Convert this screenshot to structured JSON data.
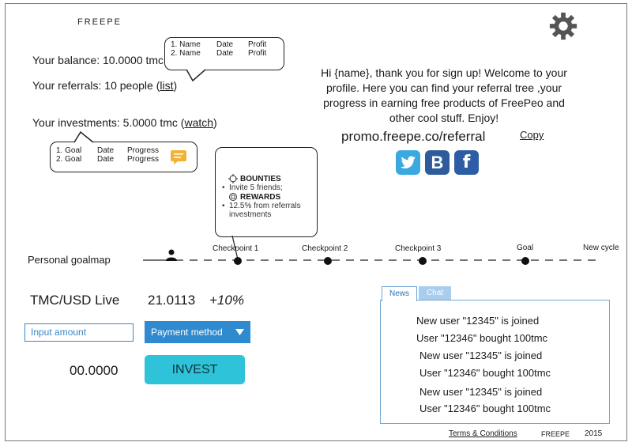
{
  "brand": "FREEPE",
  "icons": {
    "settings": "gear-icon",
    "goal_user": "user-icon",
    "bounties": "target-icon",
    "rewards": "gift-icon",
    "comment": "comment-icon",
    "dropdown": "caret-down-icon"
  },
  "colors": {
    "accent": "#2f8ad0",
    "invest": "#2ec3d8",
    "twitter": "#39a9e0",
    "vk": "#2e5c9a",
    "facebook": "#2d5ea5",
    "comment": "#f2b233"
  },
  "balance": {
    "label": "Your balance: 10.0000 tmc"
  },
  "referrals": {
    "label": "Your referrals: 10 people (",
    "link": "list",
    "close": ")"
  },
  "investments": {
    "label": "Your investments: 5.0000 tmc (",
    "link": "watch",
    "close": ")"
  },
  "referral_popup": {
    "rows": [
      {
        "c1": "1. Name",
        "c2": "Date",
        "c3": "Profit"
      },
      {
        "c1": "2. Name",
        "c2": "Date",
        "c3": "Profit"
      }
    ]
  },
  "investment_popup": {
    "rows": [
      {
        "c1": "1. Goal",
        "c2": "Date",
        "c3": "Progress"
      },
      {
        "c1": "2. Goal",
        "c2": "Date",
        "c3": "Progress"
      }
    ]
  },
  "welcome": "Hi {name}, thank you for sign up! Welcome to your profile. Here you can find your referral tree ,your progress in earning free products of FreePeo and other cool stuff. Enjoy!",
  "promo": {
    "url": "promo.freepe.co/referral",
    "copy": "Copy"
  },
  "goal_popup": {
    "bounties_title": "BOUNTIES",
    "bounties_item": "Invite 5 friends;",
    "rewards_title": "REWARDS",
    "rewards_item": "12.5% from referrals investments"
  },
  "goalmap": {
    "label": "Personal goalmap",
    "checkpoints": [
      "Checkpoint 1",
      "Checkpoint 2",
      "Checkpoint 3",
      "Goal",
      "New cycle"
    ]
  },
  "ticker": {
    "pair": "TMC/USD Live",
    "rate": "21.0113",
    "change": "+10%"
  },
  "invest": {
    "input_placeholder": "Input amount",
    "payment": "Payment method",
    "amount": "00.0000",
    "button": "INVEST"
  },
  "feed": {
    "tabs": [
      "News",
      "Chat"
    ],
    "items": [
      "New user \"12345\" is joined",
      "User \"12346\" bought 100tmc",
      "New user \"12345\" is joined",
      "User \"12346\" bought 100tmc",
      "New user \"12345\" is joined",
      "User \"12346\" bought 100tmc"
    ]
  },
  "footer": {
    "terms": "Terms & Conditions",
    "brand": "FREEPE",
    "year": "2015"
  }
}
